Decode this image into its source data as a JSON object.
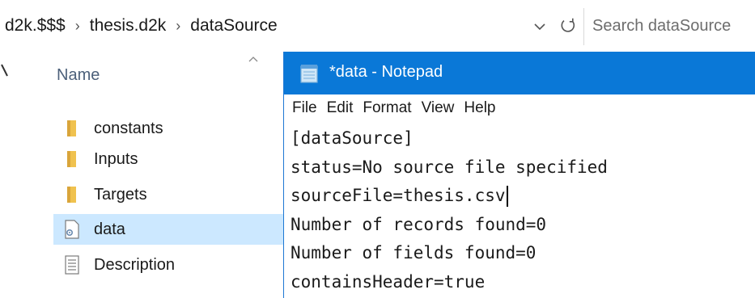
{
  "explorer": {
    "breadcrumb": [
      "d2k.$$$",
      "thesis.d2k",
      "dataSource"
    ],
    "search_placeholder": "Search dataSource",
    "column_header": "Name",
    "items": [
      {
        "label": "constants",
        "icon": "folder-icon"
      },
      {
        "label": "Inputs",
        "icon": "folder-icon"
      },
      {
        "label": "Targets",
        "icon": "folder-icon"
      },
      {
        "label": "data",
        "icon": "settings-file-icon",
        "selected": true
      },
      {
        "label": "Description",
        "icon": "text-file-icon"
      }
    ]
  },
  "notepad": {
    "title": "*data - Notepad",
    "menu": [
      "File",
      "Edit",
      "Format",
      "View",
      "Help"
    ],
    "lines": [
      "[dataSource]",
      "status=No source file specified",
      "sourceFile=thesis.csv",
      "Number of records found=0",
      "Number of fields found=0",
      "containsHeader=true"
    ]
  },
  "colors": {
    "titlebar": "#0a78d7",
    "folder": "#f0c24f",
    "selection": "#cce8ff"
  }
}
